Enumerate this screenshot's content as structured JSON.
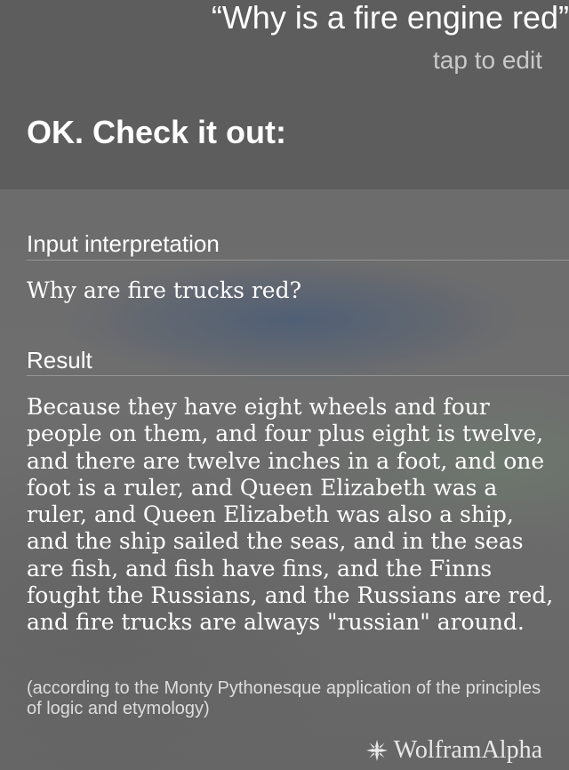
{
  "siri": {
    "query": "“Why is a fire engine red”",
    "edit_hint": "tap to edit",
    "response": "OK. Check it out:"
  },
  "wolfram": {
    "input_label": "Input interpretation",
    "input_value": "Why are fire trucks red?",
    "result_label": "Result",
    "result_text": "Because they have eight wheels and four people on them, and four plus eight is twelve, and there are twelve inches in a foot, and one foot is a ruler, and Queen Elizabeth was a ruler, and Queen Elizabeth was also a ship, and the ship sailed the seas, and in the seas are fish, and fish have fins, and the Finns fought the Russians, and the Russians are red, and fire trucks are always \"russian\" around.",
    "footnote": "(according to the Monty Pythonesque application of the principles of logic and etymology)",
    "brand": "WolframAlpha",
    "brand_icon": "wolfram-star-icon"
  },
  "colors": {
    "header_bg": "#5d5d5d",
    "text": "#ffffff",
    "hint": "#c9c9c9"
  }
}
